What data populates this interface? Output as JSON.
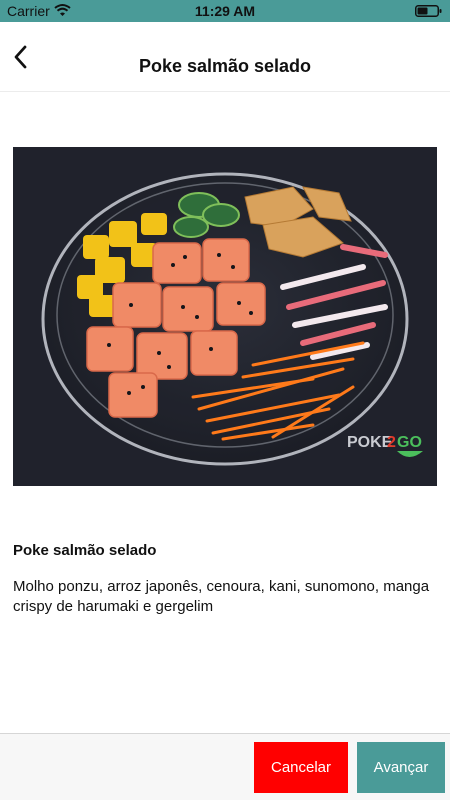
{
  "status_bar": {
    "carrier": "Carrier",
    "time": "11:29 AM",
    "icons": [
      "wifi-icon",
      "battery-icon"
    ],
    "color": "#4a9b98"
  },
  "nav": {
    "title": "Poke salmão selado",
    "back_icon": "chevron-left-icon"
  },
  "product": {
    "photo_watermark": "POKE2GO",
    "name": "Poke salmão selado",
    "description": "Molho ponzu, arroz japonês, cenoura, kani, sunomono, manga crispy de harumaki e gergelim"
  },
  "footer": {
    "cancel_label": "Cancelar",
    "next_label": "Avançar",
    "cancel_color": "#ff0000",
    "next_color": "#4a9b98"
  }
}
